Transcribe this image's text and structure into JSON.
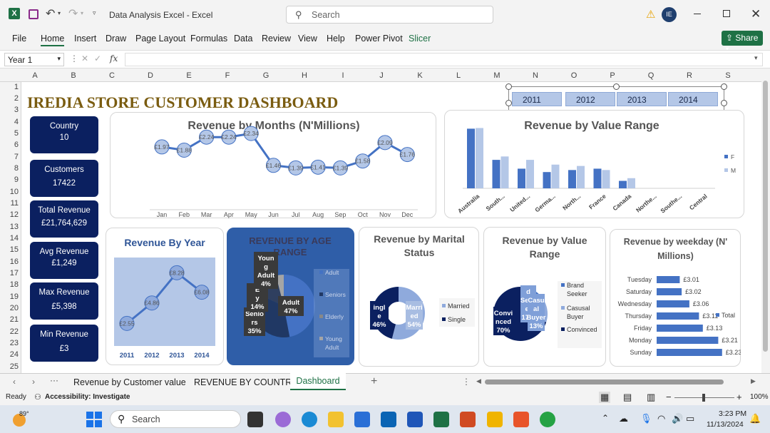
{
  "window": {
    "title": "Data Analysis Excel  -  Excel",
    "search_placeholder": "Search",
    "user_initials": "IE"
  },
  "menu": [
    "File",
    "Home",
    "Insert",
    "Draw",
    "Page Layout",
    "Formulas",
    "Data",
    "Review",
    "View",
    "Help",
    "Power Pivot",
    "Slicer"
  ],
  "share_label": "Share",
  "formula_bar": {
    "name_box": "Year 1",
    "fx": "fx"
  },
  "columns": [
    "A",
    "B",
    "C",
    "D",
    "E",
    "F",
    "G",
    "H",
    "I",
    "J",
    "K",
    "L",
    "M",
    "N",
    "O",
    "P",
    "Q",
    "R",
    "S"
  ],
  "rows": [
    "1",
    "2",
    "3",
    "4",
    "5",
    "6",
    "7",
    "8",
    "9",
    "10",
    "11",
    "12",
    "13",
    "14",
    "15",
    "16",
    "17",
    "18",
    "19",
    "20",
    "21",
    "22",
    "23",
    "24",
    "25"
  ],
  "dashboard": {
    "title": "IREDIA STORE CUSTOMER DASHBOARD",
    "slicer_years": [
      "2011",
      "2012",
      "2013",
      "2014"
    ],
    "kpis": [
      {
        "label": "Country",
        "value": "10"
      },
      {
        "label": "Customers",
        "value": "17422"
      },
      {
        "label": "Total Revenue",
        "value": "£21,764,629"
      },
      {
        "label": "Avg Revenue",
        "value": "£1,249"
      },
      {
        "label": "Max Revenue",
        "value": "£5,398"
      },
      {
        "label": "Min Revenue",
        "value": "£3"
      }
    ],
    "months_title": "Revenue by Months (N'Millions)",
    "value_range_title": "Revenue by Value Range",
    "year_title": "Revenue By Year",
    "age_title": "REVENUE BY AGE RANGE",
    "marital_title": "Revenue by Marital Status",
    "value_range2_title": "Revenue by Value Range",
    "weekday_title": "Revenue by weekday (N' Millions)"
  },
  "chart_data": [
    {
      "type": "line",
      "title": "Revenue by Months (N'Millions)",
      "categories": [
        "Jan",
        "Feb",
        "Mar",
        "Apr",
        "May",
        "Jun",
        "Jul",
        "Aug",
        "Sep",
        "Oct",
        "Nov",
        "Dec"
      ],
      "values": [
        1.97,
        1.88,
        2.24,
        2.24,
        2.34,
        1.46,
        1.39,
        1.41,
        1.39,
        1.58,
        2.09,
        1.76
      ],
      "labels": [
        "£1.97",
        "£1.88",
        "£2.24",
        "£2.24",
        "£2.34",
        "£1.46",
        "£1.39",
        "£1.41",
        "£1.39",
        "£1.58",
        "£2.09",
        "£1.76"
      ]
    },
    {
      "type": "bar",
      "title": "Revenue by Value Range",
      "categories": [
        "Australia",
        "South...",
        "United...",
        "Germa...",
        "North...",
        "France",
        "Canada",
        "Northe...",
        "Southe...",
        "Central"
      ],
      "series": [
        {
          "name": "F",
          "values": [
            88,
            42,
            29,
            24,
            27,
            29,
            11,
            0,
            0,
            0
          ]
        },
        {
          "name": "M",
          "values": [
            89,
            47,
            42,
            35,
            33,
            27,
            15,
            0,
            0,
            0
          ]
        }
      ],
      "legend": "right"
    },
    {
      "type": "area",
      "title": "Revenue By Year",
      "categories": [
        "2011",
        "2012",
        "2013",
        "2014"
      ],
      "values": [
        2.55,
        4.86,
        8.28,
        6.08
      ],
      "labels": [
        "£2.55",
        "£4.86",
        "£8.28",
        "£6.08"
      ]
    },
    {
      "type": "pie",
      "title": "REVENUE BY AGE RANGE",
      "categories": [
        "Adult",
        "Seniors",
        "Elderly",
        "Young Adult"
      ],
      "values": [
        47,
        35,
        14,
        4
      ],
      "slice_labels": [
        "Adult 47%",
        "Seniors 35%",
        "Elderly 14%",
        "Young Adult 4%"
      ]
    },
    {
      "type": "pie",
      "title": "Revenue by Marital Status",
      "categories": [
        "Married",
        "Single"
      ],
      "values": [
        54,
        46
      ],
      "slice_labels": [
        "Married 54%",
        "Single 46%"
      ]
    },
    {
      "type": "pie",
      "title": "Revenue by Value Range",
      "categories": [
        "Brand Seeker",
        "Casusal Buyer",
        "Convinced"
      ],
      "values": [
        17,
        13,
        70
      ],
      "slice_labels": [
        "Brand Seeker 17%",
        "Casusal Buyer 13%",
        "Convinced 70%"
      ]
    },
    {
      "type": "bar",
      "title": "Revenue by weekday (N' Millions)",
      "categories": [
        "Tuesday",
        "Saturday",
        "Wednesday",
        "Thursday",
        "Friday",
        "Monday",
        "Sunday"
      ],
      "values": [
        3.01,
        3.02,
        3.06,
        3.11,
        3.13,
        3.21,
        3.23
      ],
      "labels": [
        "£3.01",
        "£3.02",
        "£3.06",
        "£3.11",
        "£3.13",
        "£3.21",
        "£3.23"
      ],
      "series_name": "Total"
    }
  ],
  "sheet_tabs": [
    "Revenue by Customer value",
    "REVENUE BY COUNTRY",
    "Dashboard"
  ],
  "status": {
    "ready": "Ready",
    "accessibility": "Accessibility: Investigate",
    "zoom": "100%"
  },
  "taskbar": {
    "temp": "89°",
    "search": "Search",
    "time": "3:23 PM",
    "date": "11/13/2024"
  },
  "colors": {
    "navy": "#0b2060",
    "blue": "#4472c4",
    "light_blue": "#b4c7e7",
    "title_gold": "#7a5c10",
    "excel_green": "#1e7145"
  }
}
